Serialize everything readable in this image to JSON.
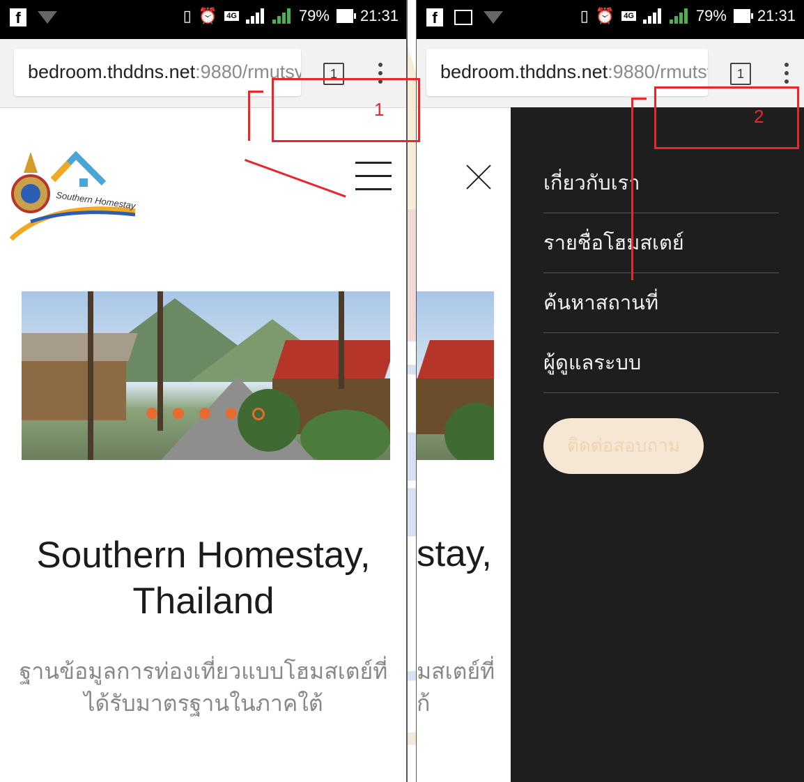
{
  "status_bar": {
    "left_icons": [
      "facebook-icon",
      "wifi-icon",
      "gallery-icon"
    ],
    "battery": "79%",
    "time": "21:31",
    "network": "4G"
  },
  "left_screen": {
    "url_host": "bedroom.thddns.net",
    "url_rest": ":9880/rmutsv",
    "tab_count": "1",
    "logo_text": "Southern Homestay",
    "site_title_line1": "Southern Homestay,",
    "site_title_line2": "Thailand",
    "site_subtitle_line1": "ฐานข้อมูลการท่องเที่ยวแบบโฮมสเตย์ที่",
    "site_subtitle_line2": "ได้รับมาตรฐานในภาคใต้",
    "carousel_total": 5,
    "carousel_active": 5
  },
  "right_screen": {
    "url_host": "bedroom.thddns.net",
    "url_rest": ":9880/rmutsv",
    "tab_count": "1",
    "partial_title": "stay,",
    "partial_subtitle_1": "มสเตย์ที่",
    "partial_subtitle_2": "ก้",
    "menu": [
      {
        "label": "เกี่ยวกับเรา"
      },
      {
        "label": "รายชื่อโฮมสเตย์"
      },
      {
        "label": "ค้นหาสถานที่"
      },
      {
        "label": "ผู้ดูแลระบบ"
      }
    ],
    "contact_button": "ติดต่อสอบถาม"
  },
  "annotations": {
    "label_1": "1",
    "label_2": "2",
    "color": "#e8262c"
  },
  "colors": {
    "accent_orange": "#e86a2e",
    "menu_bg": "#1e1e1e"
  }
}
